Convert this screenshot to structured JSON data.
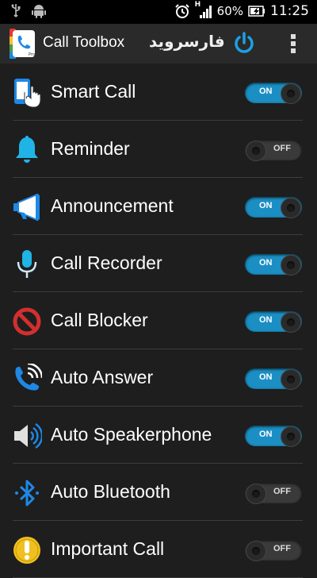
{
  "status_bar": {
    "left_icons": [
      "usb-icon",
      "android-icon"
    ],
    "signal_label": "H",
    "battery": "60%",
    "time": "11:25"
  },
  "app_bar": {
    "title": "Call Toolbox",
    "watermark": "فارسروید"
  },
  "colors": {
    "accent": "#1b8fc4",
    "toggle_off": "#3a3a3a",
    "background": "#1e1e1e",
    "bell": "#20b4e6",
    "blocker": "#d32f2f",
    "important": "#f0c020"
  },
  "features": [
    {
      "label": "Smart Call",
      "icon": "smart-call-icon",
      "state": "ON"
    },
    {
      "label": "Reminder",
      "icon": "bell-icon",
      "state": "OFF"
    },
    {
      "label": "Announcement",
      "icon": "megaphone-icon",
      "state": "ON"
    },
    {
      "label": "Call Recorder",
      "icon": "microphone-icon",
      "state": "ON"
    },
    {
      "label": "Call Blocker",
      "icon": "block-icon",
      "state": "ON"
    },
    {
      "label": "Auto Answer",
      "icon": "phone-ringing-icon",
      "state": "ON"
    },
    {
      "label": "Auto Speakerphone",
      "icon": "speaker-icon",
      "state": "ON"
    },
    {
      "label": "Auto Bluetooth",
      "icon": "bluetooth-icon",
      "state": "OFF"
    },
    {
      "label": "Important Call",
      "icon": "exclamation-icon",
      "state": "OFF"
    }
  ]
}
